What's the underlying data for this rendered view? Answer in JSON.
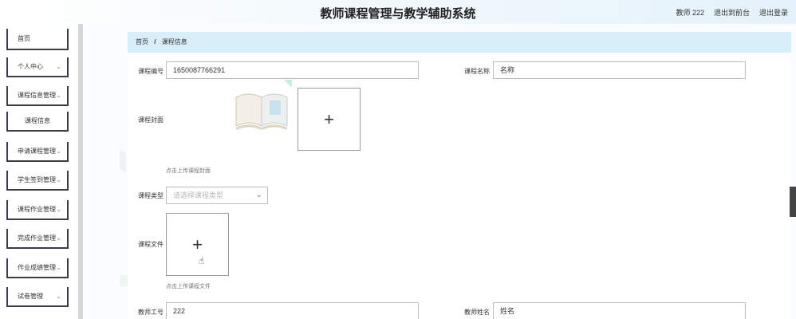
{
  "header": {
    "title": "教师课程管理与教学辅助系统",
    "user": "教师 222",
    "front_link": "退出到前台",
    "logout_link": "退出登录"
  },
  "sidebar": {
    "items": [
      {
        "label": "首页",
        "has_chevron": false
      },
      {
        "label": "个人中心",
        "has_chevron": true
      },
      {
        "label": "课程信息管理",
        "has_chevron": true
      },
      {
        "label": "课程信息",
        "has_chevron": false
      },
      {
        "label": "申请课程管理",
        "has_chevron": true
      },
      {
        "label": "学生签到管理",
        "has_chevron": true
      },
      {
        "label": "课程作业管理",
        "has_chevron": true
      },
      {
        "label": "完成作业管理",
        "has_chevron": true
      },
      {
        "label": "作业成绩管理",
        "has_chevron": true
      },
      {
        "label": "试卷管理",
        "has_chevron": true
      }
    ],
    "chevron": "chevron-down-icon"
  },
  "breadcrumb": {
    "home": "首页",
    "separator": "/",
    "current": "课程信息"
  },
  "form": {
    "course_no_label": "课程编号",
    "course_no_value": "1650087766291",
    "course_name_label": "课程名称",
    "course_name_value": "名称",
    "cover_label": "课程封面",
    "cover_hint": "点击上传课程封面",
    "type_label": "课程类型",
    "type_placeholder": "请选择课程类型",
    "file_label": "课程文件",
    "file_hint": "点击上传课程文件",
    "teacher_no_label": "教师工号",
    "teacher_no_value": "222",
    "teacher_name_label": "教师姓名",
    "teacher_name_value": "姓名"
  },
  "colors": {
    "breadcrumb_bg": "#d8eef9",
    "sidebar_border": "#3a3a4a",
    "accent_teal": "#c9ece2"
  }
}
